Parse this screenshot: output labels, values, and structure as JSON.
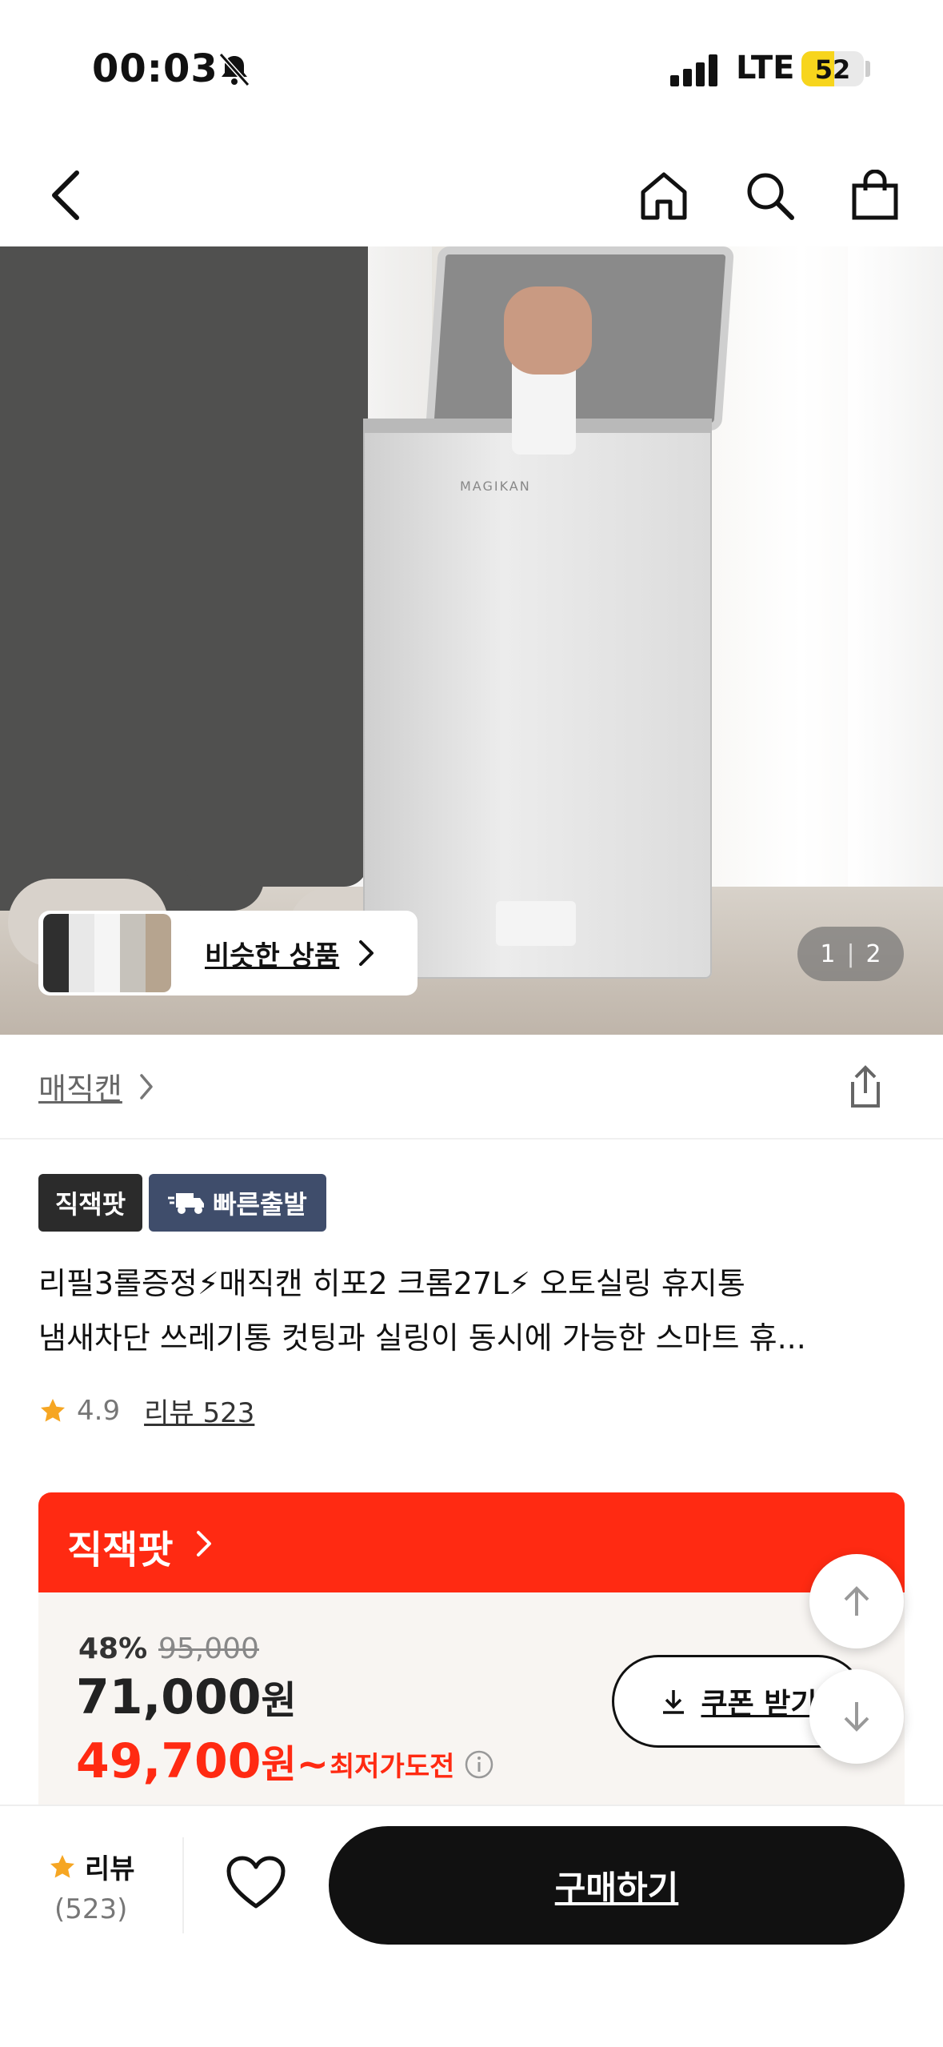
{
  "status_bar": {
    "time": "00:03",
    "network": "LTE",
    "battery": "52",
    "battery_level": 0.52
  },
  "nav": {
    "back_icon": "chevron-left-icon",
    "home_icon": "home-icon",
    "search_icon": "search-icon",
    "cart_icon": "shopping-bag-icon"
  },
  "hero": {
    "similar_label": "비슷한 상품",
    "page_current": "1",
    "page_total": "2"
  },
  "brand": {
    "name": "매직캔"
  },
  "badges": {
    "direct": "직잭팟",
    "fast": "빠른출발"
  },
  "product": {
    "title_line1": "리필3롤증정⚡매직캔 히포2 크롬27L⚡ 오토실링 휴지통",
    "title_line2": "냄새차단 쓰레기통 컷팅과 실링이 동시에 가능한 스마트 휴...",
    "rating": "4.9",
    "review_link": "리뷰 523"
  },
  "deal": {
    "header": "직잭팟",
    "discount": "48%",
    "original_price": "95,000",
    "price": "71,000",
    "price_unit": "원",
    "sale_price": "49,700",
    "sale_unit": "원~",
    "lowest_label": "최저가도전",
    "coupon_label": "쿠폰 받기"
  },
  "bottom": {
    "review_label": "리뷰",
    "review_count": "(523)",
    "buy_label": "구매하기"
  },
  "colors": {
    "accent_red": "#ff2a12",
    "badge_dark": "#2b2b2b",
    "badge_blue": "#3f4d6b",
    "star": "#f6a623"
  }
}
